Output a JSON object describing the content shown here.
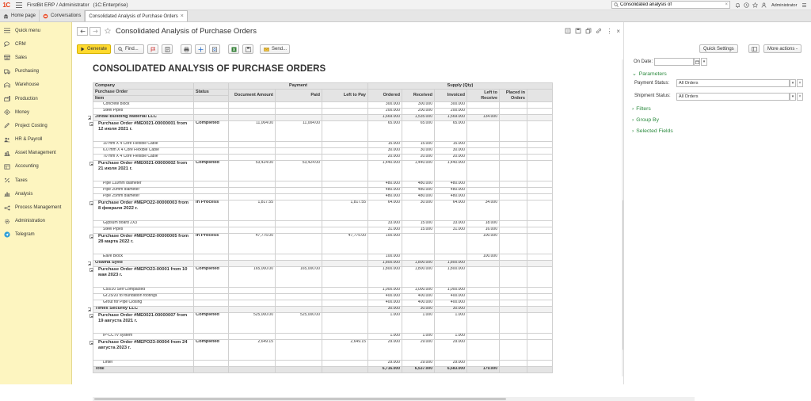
{
  "app": {
    "logo_text": "1C",
    "title": "FirstBit ERP / Administrator",
    "edition": "(1C:Enterprise)",
    "search_value": "Consolidated analysis of",
    "user": "Administrator"
  },
  "tabs": [
    {
      "label": "Home page"
    },
    {
      "label": "Conversations"
    },
    {
      "label": "Consolidated Analysis of Purchase Orders"
    }
  ],
  "sidebar": {
    "items": [
      {
        "label": "Quick menu",
        "icon": "hamburger-icon"
      },
      {
        "label": "CRM",
        "icon": "chat-icon"
      },
      {
        "label": "Sales",
        "icon": "shop-icon"
      },
      {
        "label": "Purchasing",
        "icon": "truck-icon"
      },
      {
        "label": "Warehouse",
        "icon": "warehouse-icon"
      },
      {
        "label": "Production",
        "icon": "factory-icon"
      },
      {
        "label": "Money",
        "icon": "money-icon"
      },
      {
        "label": "Project Costing",
        "icon": "pencil-icon"
      },
      {
        "label": "HR & Payroll",
        "icon": "people-icon"
      },
      {
        "label": "Asset Management",
        "icon": "asset-icon"
      },
      {
        "label": "Accounting",
        "icon": "ledger-icon"
      },
      {
        "label": "Taxes",
        "icon": "percent-icon"
      },
      {
        "label": "Analysis",
        "icon": "bar-chart-icon"
      },
      {
        "label": "Process Management",
        "icon": "process-icon"
      },
      {
        "label": "Administration",
        "icon": "gear-icon"
      },
      {
        "label": "Telegram",
        "icon": "telegram-icon"
      }
    ]
  },
  "form": {
    "title": "Consolidated Analysis of Purchase Orders",
    "generate": "Generate",
    "find": "Find...",
    "send": "Send...",
    "quick_settings": "Quick Settings",
    "more_actions": "More actions -"
  },
  "report": {
    "title": "CONSOLIDATED ANALYSIS OF PURCHASE ORDERS",
    "headers": {
      "company": "Company",
      "purchase_order": "Purchase Order",
      "item": "Item",
      "status": "Status",
      "payment": "Payment",
      "document_amount": "Document Amount",
      "paid": "Paid",
      "left_to_pay": "Left to Pay",
      "supply": "Supply (Qty)",
      "ordered": "Ordered",
      "received": "Received",
      "invoiced": "Invoiced",
      "left_to_receive": "Left to Receive",
      "placed_in_orders": "Placed in Orders"
    },
    "rows": [
      {
        "type": "item",
        "name": "Concrete block",
        "status": "",
        "doc": "",
        "paid": "",
        "ltp": "",
        "ord": "300.000",
        "rec": "300.000",
        "inv": "300.000",
        "ltr": "",
        "pio": ""
      },
      {
        "type": "item",
        "name": "Steel Pipes",
        "status": "",
        "doc": "",
        "paid": "",
        "ltp": "",
        "ord": "200.000",
        "rec": "200.000",
        "inv": "200.000",
        "ltr": "",
        "pio": ""
      },
      {
        "type": "vend",
        "name": "Jindal Building Material LLC",
        "status": "",
        "doc": "",
        "paid": "",
        "ltp": "",
        "ord": "1,669.000",
        "rec": "1,535.000",
        "inv": "1,569.000",
        "ltr": "134.000",
        "pio": ""
      },
      {
        "type": "order",
        "name": "Purchase Order #ME0021-00000001 from 12 июля 2021 г.",
        "status": "Completed",
        "doc": "11,004.00",
        "paid": "11,004.00",
        "ltp": "",
        "ord": "65.000",
        "rec": "65.000",
        "inv": "65.000",
        "ltr": "",
        "pio": ""
      },
      {
        "type": "item",
        "name": "10 mm X 4 Core Flexible Cable",
        "status": "",
        "doc": "",
        "paid": "",
        "ltp": "",
        "ord": "15.000",
        "rec": "15.000",
        "inv": "15.000",
        "ltr": "",
        "pio": ""
      },
      {
        "type": "item",
        "name": "6.0 mm X 4 Core Flexible Cable",
        "status": "",
        "doc": "",
        "paid": "",
        "ltp": "",
        "ord": "30.000",
        "rec": "30.000",
        "inv": "30.000",
        "ltr": "",
        "pio": ""
      },
      {
        "type": "item",
        "name": "70 mm X 4 Core Flexible Cable",
        "status": "",
        "doc": "",
        "paid": "",
        "ltp": "",
        "ord": "20.000",
        "rec": "20.000",
        "inv": "20.000",
        "ltr": "",
        "pio": ""
      },
      {
        "type": "order",
        "name": "Purchase Order #ME0021-00000002 from 21 июля 2021 г.",
        "status": "Completed",
        "doc": "53,424.00",
        "paid": "53,424.00",
        "ltp": "",
        "ord": "1,440.000",
        "rec": "1,440.000",
        "inv": "1,440.000",
        "ltr": "",
        "pio": ""
      },
      {
        "type": "item",
        "name": "Pipe 110mm diameter",
        "status": "",
        "doc": "",
        "paid": "",
        "ltp": "",
        "ord": "480.000",
        "rec": "480.000",
        "inv": "480.000",
        "ltr": "",
        "pio": ""
      },
      {
        "type": "item",
        "name": "Pipe 20mm diameter",
        "status": "",
        "doc": "",
        "paid": "",
        "ltp": "",
        "ord": "480.000",
        "rec": "480.000",
        "inv": "480.000",
        "ltr": "",
        "pio": ""
      },
      {
        "type": "item",
        "name": "Pipe 25mm diameter",
        "status": "",
        "doc": "",
        "paid": "",
        "ltp": "",
        "ord": "480.000",
        "rec": "480.000",
        "inv": "480.000",
        "ltr": "",
        "pio": ""
      },
      {
        "type": "order",
        "name": "Purchase Order #MEPO22-00000003 from 8 февраля 2022 г.",
        "status": "In Process",
        "doc": "1,817.55",
        "paid": "",
        "ltp": "1,817.55",
        "ord": "64.000",
        "rec": "30.000",
        "inv": "64.000",
        "ltr": "34.000",
        "pio": ""
      },
      {
        "type": "item",
        "name": "Gypsum board 2X3",
        "status": "",
        "doc": "",
        "paid": "",
        "ltp": "",
        "ord": "33.000",
        "rec": "15.000",
        "inv": "33.000",
        "ltr": "18.000",
        "pio": ""
      },
      {
        "type": "item",
        "name": "Steel Pipes",
        "status": "",
        "doc": "",
        "paid": "",
        "ltp": "",
        "ord": "31.000",
        "rec": "15.000",
        "inv": "31.000",
        "ltr": "16.000",
        "pio": ""
      },
      {
        "type": "order",
        "name": "Purchase Order #MEPO22-00000005 from 28 марта 2022 г.",
        "status": "In Process",
        "doc": "47,775.00",
        "paid": "",
        "ltp": "47,775.00",
        "ord": "100.000",
        "rec": "",
        "inv": "",
        "ltr": "100.000",
        "pio": ""
      },
      {
        "type": "item",
        "name": "Eave Block",
        "status": "",
        "doc": "",
        "paid": "",
        "ltp": "",
        "ord": "100.000",
        "rec": "",
        "inv": "",
        "ltr": "100.000",
        "pio": ""
      },
      {
        "type": "vend",
        "name": "Osama Syed",
        "status": "",
        "doc": "",
        "paid": "",
        "ltp": "",
        "ord": "1,800.000",
        "rec": "1,800.000",
        "inv": "1,800.000",
        "ltr": "",
        "pio": ""
      },
      {
        "type": "order",
        "name": "Purchase Order #MEPO23-00001 from 10 мая 2023 г.",
        "status": "Completed",
        "doc": "165,000.00",
        "paid": "165,000.00",
        "ltp": "",
        "ord": "1,800.000",
        "rec": "1,800.000",
        "inv": "1,800.000",
        "ltr": "",
        "pio": ""
      },
      {
        "type": "item",
        "name": "C50/20 Self Compacted",
        "status": "",
        "doc": "",
        "paid": "",
        "ltp": "",
        "ord": "1,000.000",
        "rec": "1,000.000",
        "inv": "1,000.000",
        "ltr": "",
        "pio": ""
      },
      {
        "type": "item",
        "name": "Gr.25/20 to foundation footings",
        "status": "",
        "doc": "",
        "paid": "",
        "ltp": "",
        "ord": "400.000",
        "rec": "400.000",
        "inv": "400.000",
        "ltr": "",
        "pio": ""
      },
      {
        "type": "item",
        "name": "Grout for Pipe Closing",
        "status": "",
        "doc": "",
        "paid": "",
        "ltp": "",
        "ord": "400.000",
        "rec": "400.000",
        "inv": "400.000",
        "ltr": "",
        "pio": ""
      },
      {
        "type": "vend",
        "name": "Times Security LLC",
        "status": "",
        "doc": "",
        "paid": "",
        "ltp": "",
        "ord": "30.000",
        "rec": "30.000",
        "inv": "30.000",
        "ltr": "",
        "pio": ""
      },
      {
        "type": "order",
        "name": "Purchase Order #ME0021-00000007 from 19 августа 2021 г.",
        "status": "Completed",
        "doc": "525,000.00",
        "paid": "525,000.00",
        "ltp": "",
        "ord": "1.000",
        "rec": "1.000",
        "inv": "1.000",
        "ltr": "",
        "pio": ""
      },
      {
        "type": "item",
        "name": "IP-CCTV system",
        "status": "",
        "doc": "",
        "paid": "",
        "ltp": "",
        "ord": "1.000",
        "rec": "1.000",
        "inv": "1.000",
        "ltr": "",
        "pio": ""
      },
      {
        "type": "order",
        "name": "Purchase Order #MEPO23-00004 from 24 августа 2023 г.",
        "status": "Completed",
        "doc": "2,649.15",
        "paid": "",
        "ltp": "2,649.15",
        "ord": "29.000",
        "rec": "29.000",
        "inv": "29.000",
        "ltr": "",
        "pio": ""
      },
      {
        "type": "item",
        "name": "Lintel",
        "status": "",
        "doc": "",
        "paid": "",
        "ltp": "",
        "ord": "29.000",
        "rec": "29.000",
        "inv": "29.000",
        "ltr": "",
        "pio": ""
      },
      {
        "type": "total",
        "name": "Total",
        "status": "",
        "doc": "",
        "paid": "",
        "ltp": "",
        "ord": "6,716.000",
        "rec": "6,537.000",
        "inv": "6,583.000",
        "ltr": "179.000",
        "pio": ""
      }
    ]
  },
  "settings": {
    "on_date_label": "On Date:",
    "on_date_value": "",
    "parameters": "Parameters",
    "payment_status_label": "Payment Status:",
    "payment_status_value": "All Orders",
    "shipment_status_label": "Shipment Status:",
    "shipment_status_value": "All Orders",
    "filters": "Filters",
    "group_by": "Group By",
    "selected_fields": "Selected Fields"
  },
  "colors": {
    "sidebar_bg": "#fdf5c0",
    "primary_button": "#ffd92e",
    "group_link": "#2b8a3e",
    "logo": "#e8411b"
  }
}
